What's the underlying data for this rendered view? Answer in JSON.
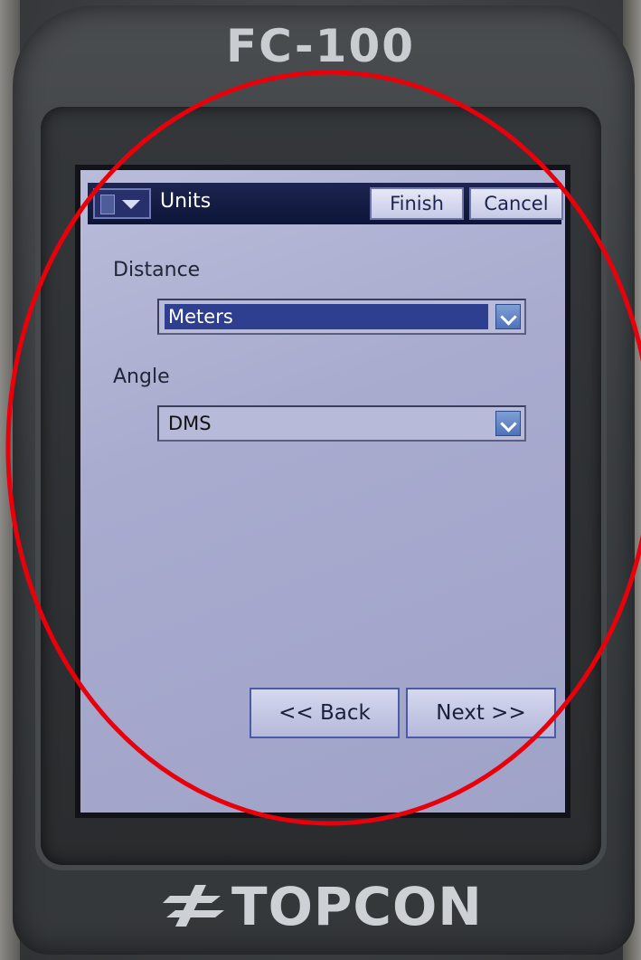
{
  "device": {
    "model": "FC-100",
    "brand": "TOPCON"
  },
  "titlebar": {
    "title": "Units",
    "finish_label": "Finish",
    "cancel_label": "Cancel",
    "start_icon": "start-menu-icon"
  },
  "form": {
    "distance_label": "Distance",
    "distance_value": "Meters",
    "angle_label": "Angle",
    "angle_value": "DMS"
  },
  "nav": {
    "back_label": "<< Back",
    "next_label": "Next >>"
  },
  "colors": {
    "annotation_circle": "#e8000b",
    "titlebar": "#0d1438",
    "screen_bg": "#a8abce"
  }
}
